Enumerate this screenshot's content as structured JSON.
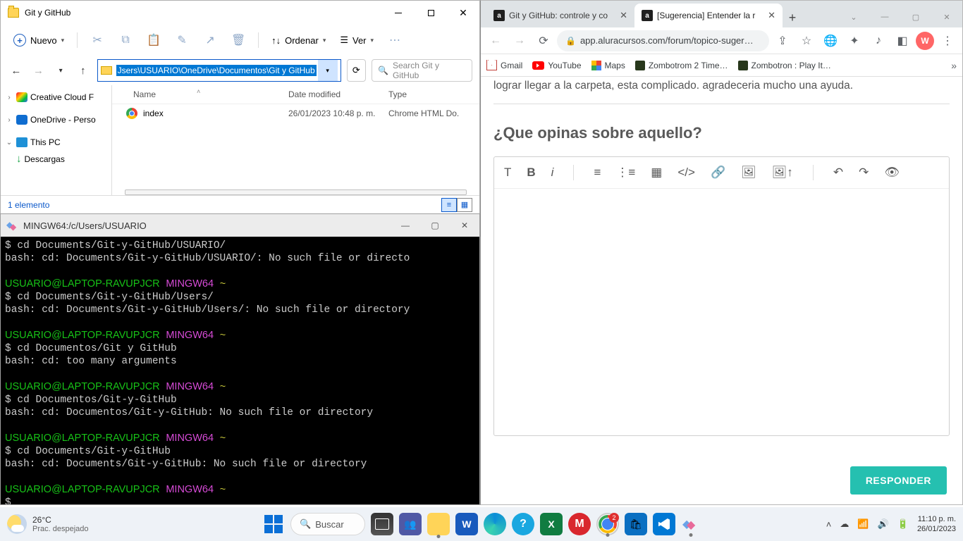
{
  "explorer": {
    "title": "Git y GitHub",
    "new_label": "Nuevo",
    "sort_label": "Ordenar",
    "view_label": "Ver",
    "address": "Jsers\\USUARIO\\OneDrive\\Documentos\\Git y GitHub",
    "search_placeholder": "Search Git y GitHub",
    "cols": {
      "name": "Name",
      "date": "Date modified",
      "type": "Type"
    },
    "tree": {
      "cc": "Creative Cloud F",
      "onedrive": "OneDrive - Perso",
      "thispc": "This PC",
      "downloads": "Descargas"
    },
    "files": [
      {
        "name": "index",
        "date": "26/01/2023 10:48 p. m.",
        "type": "Chrome HTML Do."
      }
    ],
    "status": "1 elemento"
  },
  "terminal": {
    "title": "MINGW64:/c/Users/USUARIO",
    "prompt_user": "USUARIO@LAPTOP-RAVUPJCR",
    "prompt_env": "MINGW64",
    "prompt_path": "~",
    "lines": [
      {
        "t": "cmd",
        "v": "$ cd Documents/Git-y-GitHub/USUARIO/"
      },
      {
        "t": "out",
        "v": "bash: cd: Documents/Git-y-GitHub/USUARIO/: No such file or directo"
      },
      {
        "t": "blank"
      },
      {
        "t": "prompt"
      },
      {
        "t": "cmd",
        "v": "$ cd Documents/Git-y-GitHub/Users/"
      },
      {
        "t": "out",
        "v": "bash: cd: Documents/Git-y-GitHub/Users/: No such file or directory"
      },
      {
        "t": "blank"
      },
      {
        "t": "prompt"
      },
      {
        "t": "cmd",
        "v": "$ cd Documentos/Git y GitHub"
      },
      {
        "t": "out",
        "v": "bash: cd: too many arguments"
      },
      {
        "t": "blank"
      },
      {
        "t": "prompt"
      },
      {
        "t": "cmd",
        "v": "$ cd Documentos/Git-y-GitHub"
      },
      {
        "t": "out",
        "v": "bash: cd: Documentos/Git-y-GitHub: No such file or directory"
      },
      {
        "t": "blank"
      },
      {
        "t": "prompt"
      },
      {
        "t": "cmd",
        "v": "$ cd Documents/Git-y-GitHub"
      },
      {
        "t": "out",
        "v": "bash: cd: Documents/Git-y-GitHub: No such file or directory"
      },
      {
        "t": "blank"
      },
      {
        "t": "prompt"
      },
      {
        "t": "cmd",
        "v": "$ "
      }
    ]
  },
  "chrome": {
    "tabs": [
      {
        "title": "Git y GitHub: controle y co",
        "active": false
      },
      {
        "title": "[Sugerencia] Entender la r",
        "active": true
      }
    ],
    "url": "app.aluracursos.com/forum/topico-suger…",
    "bookmarks": {
      "gmail": "Gmail",
      "youtube": "YouTube",
      "maps": "Maps",
      "zomb": "Zombotrom 2 Time…",
      "zomb2": "Zombotron : Play It…"
    },
    "page": {
      "fragment": "lograr llegar a la carpeta, esta complicado. agradeceria mucho una ayuda.",
      "question_title": "¿Que opinas sobre aquello?",
      "respond_btn": "RESPONDER"
    },
    "avatar_letter": "W"
  },
  "taskbar": {
    "temp": "26°C",
    "weather": "Prac. despejado",
    "search": "Buscar",
    "time": "11:10 p. m.",
    "date": "26/01/2023",
    "chrome_badge": "2"
  }
}
